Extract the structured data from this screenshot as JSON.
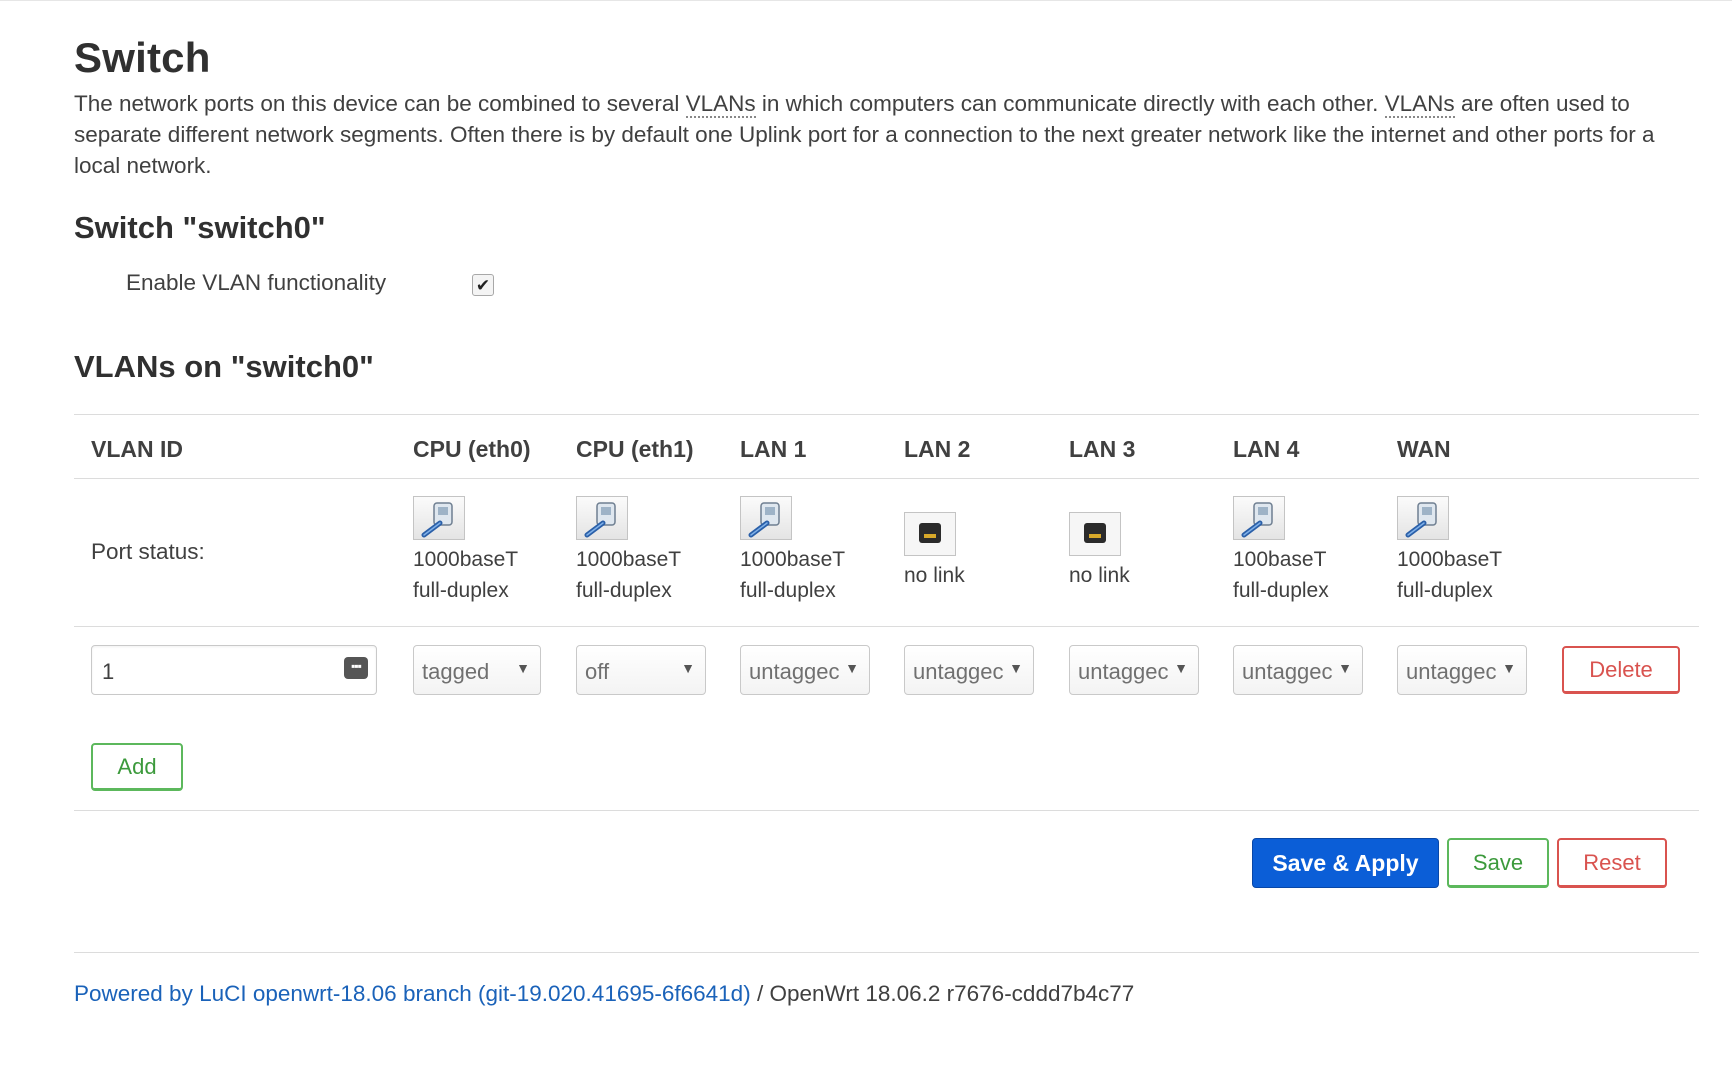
{
  "page": {
    "title": "Switch",
    "description_parts": [
      "The network ports on this device can be combined to several ",
      "VLANs",
      " in which computers can communicate directly with each other. ",
      "VLANs",
      " are often used to separate different network segments. Often there is by default one Uplink port for a connection to the next greater network like the internet and other ports for a local network."
    ]
  },
  "switch_section": {
    "title": "Switch \"switch0\"",
    "enable_vlan_label": "Enable VLAN functionality",
    "enable_vlan_checked": true,
    "enable_vlan_mark": "✔"
  },
  "vlans_section": {
    "title": "VLANs on \"switch0\"",
    "columns": [
      "VLAN ID",
      "CPU (eth0)",
      "CPU (eth1)",
      "LAN 1",
      "LAN 2",
      "LAN 3",
      "LAN 4",
      "WAN"
    ],
    "port_status_label": "Port status:",
    "ports": [
      {
        "name": "CPU (eth0)",
        "status": "up",
        "line1": "1000baseT",
        "line2": "full-duplex"
      },
      {
        "name": "CPU (eth1)",
        "status": "up",
        "line1": "1000baseT",
        "line2": "full-duplex"
      },
      {
        "name": "LAN 1",
        "status": "up",
        "line1": "1000baseT",
        "line2": "full-duplex"
      },
      {
        "name": "LAN 2",
        "status": "down",
        "line1": "no link",
        "line2": ""
      },
      {
        "name": "LAN 3",
        "status": "down",
        "line1": "no link",
        "line2": ""
      },
      {
        "name": "LAN 4",
        "status": "up",
        "line1": "100baseT",
        "line2": "full-duplex"
      },
      {
        "name": "WAN",
        "status": "up",
        "line1": "1000baseT",
        "line2": "full-duplex"
      }
    ],
    "row": {
      "vlan_id": "1",
      "selects": [
        "tagged",
        "off",
        "untaggec",
        "untaggec",
        "untaggec",
        "untaggec",
        "untaggec"
      ],
      "select_caret": "▼",
      "delete_label": "Delete"
    },
    "add_label": "Add"
  },
  "actions": {
    "save_apply_label": "Save & Apply",
    "save_label": "Save",
    "reset_label": "Reset"
  },
  "footer": {
    "link_text": "Powered by LuCI openwrt-18.06 branch (git-19.020.41695-6f6641d)",
    "rest_text": " / OpenWrt 18.06.2 r7676-cddd7b4c77"
  },
  "icons": {
    "port_up": "ethernet-cable-connected-icon",
    "port_down": "ethernet-port-empty-icon",
    "keyboard": "keyboard-icon"
  },
  "colors": {
    "primary": "#0b5ed7",
    "positive": "#5cb85c",
    "negative": "#d9534f",
    "link": "#1a62b9"
  }
}
